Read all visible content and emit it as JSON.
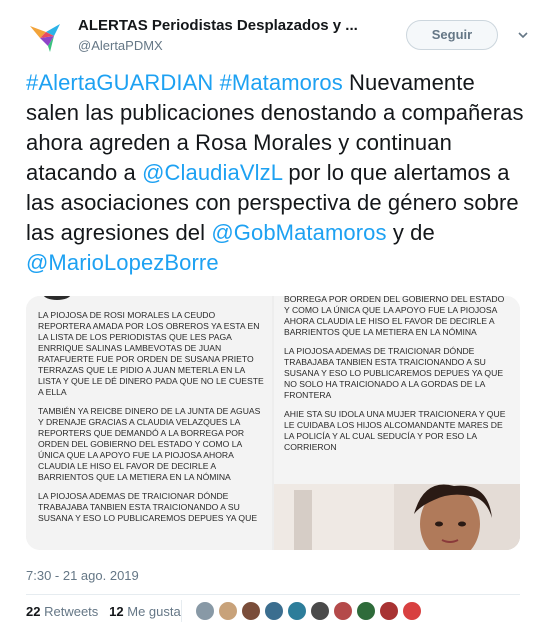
{
  "author": {
    "name": "ALERTAS Periodistas Desplazados y ...",
    "handle": "@AlertaPDMX"
  },
  "follow_label": "Seguir",
  "tweet": {
    "segments": [
      {
        "text": "#AlertaGUARDIAN",
        "link": true
      },
      {
        "text": " ",
        "link": false
      },
      {
        "text": "#Matamoros",
        "link": true
      },
      {
        "text": " Nuevamente salen las publicaciones denostando a compañeras ahora agreden a Rosa Morales y continuan atacando a ",
        "link": false
      },
      {
        "text": "@ClaudiaVlzL",
        "link": true
      },
      {
        "text": " por lo que alertamos a las asociaciones con perspectiva de género sobre las agresiones del ",
        "link": false
      },
      {
        "text": "@GobMatamoros",
        "link": true
      },
      {
        "text": " y de ",
        "link": false
      },
      {
        "text": "@MarioLopezBorre",
        "link": true
      }
    ]
  },
  "media": {
    "left_paragraphs": [
      "La piojosa de Rosi Morales la ceudo reportera amada por los obreros ya esta en la lista de los periodistas que les paga Enrrique Salinas Lambevotas de Juan Ratafuerte fue por orden de Susana Prieto Terrazas que le pidio a Juan meterla en la lista y que le dé dinero pada que no le cueste a ella",
      "También ya reicbe dinero de la junta de Aguas y Drenaje gracias a Claudia Velazques la reporters que demandó a la borrega por orden del gobierno del estado y como la única que la apoyo fue la piojosa ahora Claudia le hiso el favor de decirle a barrientos que la metiera en la nómina",
      "La piojosa ademas de traicionar dónde trabajaba tanbien esta traicionando a su Susana y eso lo publicaremos depues ya que"
    ],
    "right_paragraphs": [
      "borrega por orden del gobierno del estado y como la única que la apoyo fue la piojosa ahora Claudia le hiso el favor de decirle a barrientos que la metiera en la nómina",
      "La piojosa ademas de traicionar dónde trabajaba tanbien esta traicionando a su Susana y eso lo publicaremos depues ya que no solo ha traicionado a la gordas de la frontera",
      "Ahie sta su idola una mujer traicionera y que le cuidaba los hijos alcomandante mares de la policía y al cual seducía y por eso la corrieron"
    ]
  },
  "timestamp": "7:30 - 21 ago. 2019",
  "stats": {
    "retweets_count": "22",
    "retweets_label": "Retweets",
    "likes_count": "12",
    "likes_label": "Me gusta"
  },
  "likers": [
    "#8899a6",
    "#c8a27a",
    "#7a4d3a",
    "#3b6e8f",
    "#2d7d9a",
    "#4a4a4a",
    "#b44a4a",
    "#2e6b3a",
    "#a83232",
    "#d84040"
  ],
  "colors": {
    "link": "#1da1f2",
    "text": "#14171a",
    "secondary": "#657786"
  }
}
